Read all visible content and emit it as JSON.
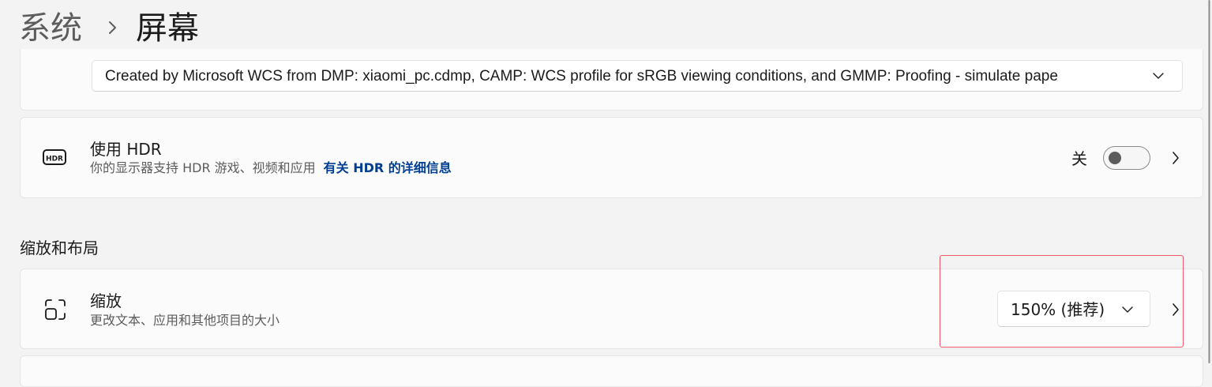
{
  "breadcrumb": {
    "parent": "系统",
    "current": "屏幕"
  },
  "color_profile": {
    "selected": "Created by Microsoft WCS from DMP: xiaomi_pc.cdmp, CAMP: WCS profile for sRGB viewing conditions, and GMMP: Proofing - simulate pape"
  },
  "hdr": {
    "icon": "hdr-icon",
    "title": "使用 HDR",
    "description": "你的显示器支持 HDR 游戏、视频和应用",
    "link": "有关 HDR 的详细信息",
    "toggle_label": "关",
    "toggle_on": false
  },
  "scale_section": {
    "heading": "缩放和布局",
    "scale": {
      "icon": "scale-icon",
      "title": "缩放",
      "description": "更改文本、应用和其他项目的大小",
      "selected": "150% (推荐)"
    }
  },
  "colors": {
    "accent_link": "#003e92",
    "highlight_box": "#f0566a",
    "background": "#f3f3f3",
    "card": "#fbfbfb"
  }
}
